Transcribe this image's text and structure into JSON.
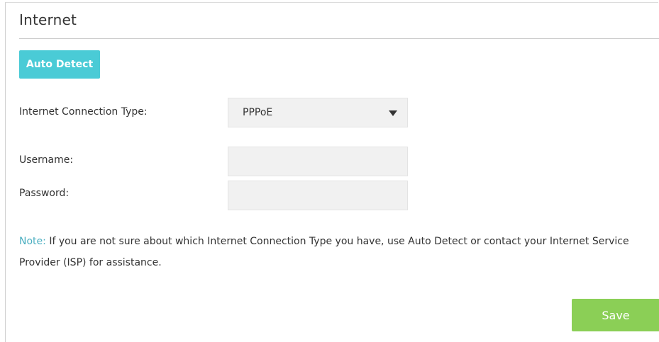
{
  "section": {
    "title": "Internet"
  },
  "auto_detect": {
    "label": "Auto Detect"
  },
  "connection_type": {
    "label": "Internet Connection Type:",
    "selected": "PPPoE"
  },
  "username": {
    "label": "Username:",
    "value": ""
  },
  "password": {
    "label": "Password:",
    "value": ""
  },
  "note": {
    "prefix": "Note:",
    "text": "If you are not sure about which Internet Connection Type you have, use Auto Detect or contact your Internet Service Provider (ISP) for assistance."
  },
  "save": {
    "label": "Save"
  },
  "colors": {
    "accent_blue": "#4acbd6",
    "save_green": "#8bcf56",
    "note_blue": "#4aaec0"
  },
  "icons": {
    "dropdown": "caret-down-icon"
  }
}
